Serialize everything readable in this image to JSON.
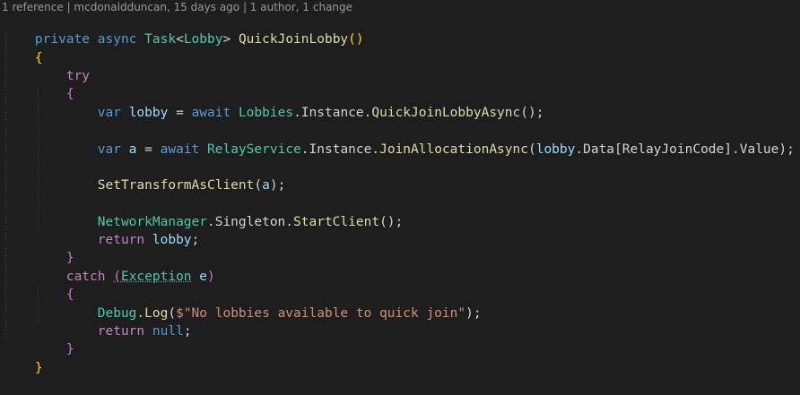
{
  "codelens": "1 reference | mcdonaldduncan, 15 days ago | 1 author, 1 change",
  "colors": {
    "background": "#1e1e1e",
    "keyword": "#569cd6",
    "control": "#c586c0",
    "type": "#4ec9b0",
    "function": "#dcdcaa",
    "variable": "#9cdcfe",
    "string": "#ce9178",
    "brace": "#ffd700",
    "paren": "#da70d6",
    "default": "#d4d4d4"
  },
  "code": {
    "l1": {
      "t1": "private",
      "t2": " ",
      "t3": "async",
      "t4": " ",
      "t5": "Task",
      "t6": "<",
      "t7": "Lobby",
      "t8": ">",
      "t9": " ",
      "t10": "QuickJoinLobby",
      "t11": "()"
    },
    "l2": {
      "t1": "{"
    },
    "l3": {
      "t1": "    ",
      "t2": "try"
    },
    "l4": {
      "t1": "    ",
      "t2": "{"
    },
    "l5": {
      "t1": "        ",
      "t2": "var",
      "t3": " ",
      "t4": "lobby",
      "t5": " = ",
      "t6": "await",
      "t7": " ",
      "t8": "Lobbies",
      "t9": ".",
      "t10": "Instance",
      "t11": ".",
      "t12": "QuickJoinLobbyAsync",
      "t13": "();"
    },
    "l6": {
      "t1": "        ",
      "t2": "var",
      "t3": " ",
      "t4": "a",
      "t5": " = ",
      "t6": "await",
      "t7": " ",
      "t8": "RelayService",
      "t9": ".",
      "t10": "Instance",
      "t11": ".",
      "t12": "JoinAllocationAsync",
      "t13": "(",
      "t14": "lobby",
      "t15": ".",
      "t16": "Data",
      "t17": "[",
      "t18": "RelayJoinCode",
      "t19": "].",
      "t20": "Value",
      "t21": ");"
    },
    "l7": {
      "t1": "        ",
      "t2": "SetTransformAsClient",
      "t3": "(",
      "t4": "a",
      "t5": ");"
    },
    "l8": {
      "t1": "        ",
      "t2": "NetworkManager",
      "t3": ".",
      "t4": "Singleton",
      "t5": ".",
      "t6": "StartClient",
      "t7": "();"
    },
    "l9": {
      "t1": "        ",
      "t2": "return",
      "t3": " ",
      "t4": "lobby",
      "t5": ";"
    },
    "l10": {
      "t1": "    ",
      "t2": "}"
    },
    "l11": {
      "t1": "    ",
      "t2": "catch",
      "t3": " ",
      "t4": "(",
      "t5": "Exception",
      "t6": " ",
      "t7": "e",
      "t8": ")"
    },
    "l12": {
      "t1": "    ",
      "t2": "{"
    },
    "l13": {
      "t1": "        ",
      "t2": "Debug",
      "t3": ".",
      "t4": "Log",
      "t5": "(",
      "t6": "$\"No lobbies available to quick join\"",
      "t7": ");"
    },
    "l14": {
      "t1": "        ",
      "t2": "return",
      "t3": " ",
      "t4": "null",
      "t5": ";"
    },
    "l15": {
      "t1": "    ",
      "t2": "}"
    },
    "l16": {
      "t1": "}"
    }
  }
}
